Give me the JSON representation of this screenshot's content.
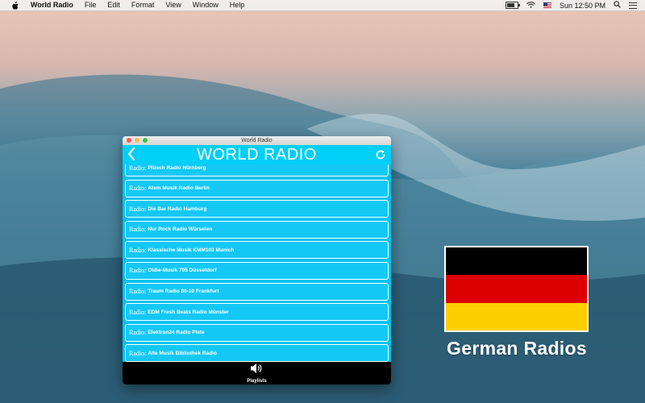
{
  "menubar": {
    "app_name": "World Radio",
    "items": [
      "File",
      "Edit",
      "Format",
      "View",
      "Window",
      "Help"
    ],
    "clock": "Sun 12:50 PM"
  },
  "window": {
    "title": "World Radio",
    "header_title": "WORLD RADIO",
    "back_icon": "chevron-left-icon",
    "refresh_icon": "refresh-icon"
  },
  "stations": {
    "prefix": "Radio:",
    "items": [
      "Plüsch Radio Nürnberg",
      "Atem Musik Radio Berlin",
      "Die Bar Radio Hamburg",
      "Nur Rock Radio Würselen",
      "Klassische Musik KMM103 Munich",
      "Oldie-Musik 705 Düsseldorf",
      "Traum Radio 80-10 Frankfurt",
      "EDM Fresh Beats Radio Münster",
      "Elektron24 Radio Plete",
      "Alte Musik Bibliothek Radio"
    ]
  },
  "bottom_bar": {
    "tab_label": "Playlists",
    "tab_icon": "speaker-icon"
  },
  "promo": {
    "caption": "German Radios",
    "flag_colors": [
      "#000000",
      "#dd0000",
      "#ffce00"
    ]
  },
  "colors": {
    "accent": "#00c2f0",
    "header": "#00cff8"
  }
}
